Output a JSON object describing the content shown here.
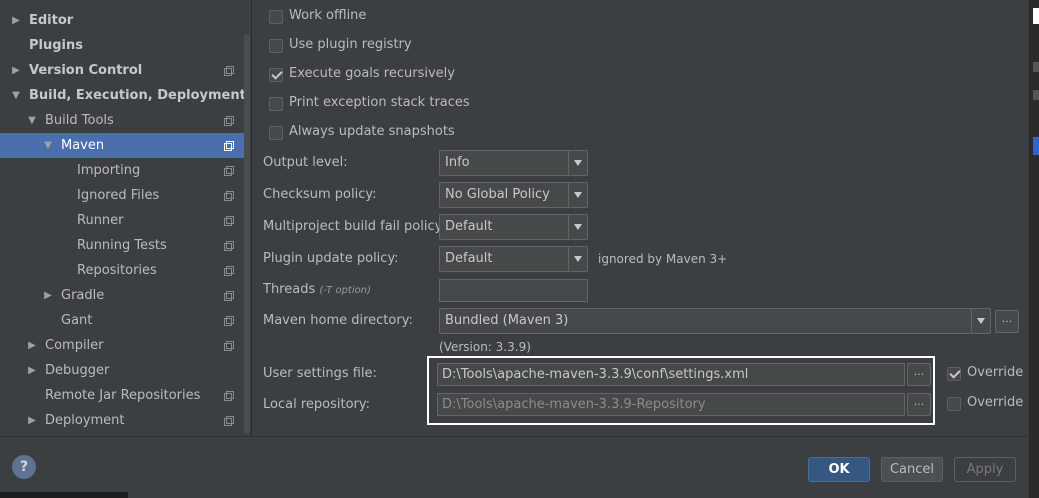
{
  "sidebar": {
    "items": [
      {
        "label": "Editor",
        "bold": true,
        "arrow": "right",
        "project": false
      },
      {
        "label": "Plugins",
        "bold": true,
        "arrow": "",
        "project": false
      },
      {
        "label": "Version Control",
        "bold": true,
        "arrow": "right",
        "project": true
      },
      {
        "label": "Build, Execution, Deployment",
        "bold": true,
        "arrow": "down",
        "project": false
      },
      {
        "label": "Build Tools",
        "bold": false,
        "arrow": "down",
        "project": true
      },
      {
        "label": "Maven",
        "bold": false,
        "arrow": "down",
        "project": true,
        "selected": true
      },
      {
        "label": "Importing",
        "bold": false,
        "arrow": "",
        "project": true
      },
      {
        "label": "Ignored Files",
        "bold": false,
        "arrow": "",
        "project": true
      },
      {
        "label": "Runner",
        "bold": false,
        "arrow": "",
        "project": true
      },
      {
        "label": "Running Tests",
        "bold": false,
        "arrow": "",
        "project": true
      },
      {
        "label": "Repositories",
        "bold": false,
        "arrow": "",
        "project": true
      },
      {
        "label": "Gradle",
        "bold": false,
        "arrow": "right",
        "project": true
      },
      {
        "label": "Gant",
        "bold": false,
        "arrow": "",
        "project": true
      },
      {
        "label": "Compiler",
        "bold": false,
        "arrow": "right",
        "project": true
      },
      {
        "label": "Debugger",
        "bold": false,
        "arrow": "right",
        "project": false
      },
      {
        "label": "Remote Jar Repositories",
        "bold": false,
        "arrow": "",
        "project": true
      },
      {
        "label": "Deployment",
        "bold": false,
        "arrow": "right",
        "project": true
      }
    ]
  },
  "options": {
    "work_offline": {
      "label": "Work offline",
      "checked": false
    },
    "use_plugin_registry": {
      "label": "Use plugin registry",
      "checked": false
    },
    "execute_goals_recursively": {
      "label": "Execute goals recursively",
      "checked": true
    },
    "print_exception_stack_traces": {
      "label": "Print exception stack traces",
      "checked": false
    },
    "always_update_snapshots": {
      "label": "Always update snapshots",
      "checked": false
    }
  },
  "form": {
    "output_level": {
      "label": "Output level:",
      "value": "Info"
    },
    "checksum_policy": {
      "label": "Checksum policy:",
      "value": "No Global Policy"
    },
    "multiproject_fail_policy": {
      "label": "Multiproject build fail policy:",
      "value": "Default"
    },
    "plugin_update_policy": {
      "label": "Plugin update policy:",
      "value": "Default",
      "note": "ignored by Maven 3+"
    },
    "threads": {
      "label": "Threads",
      "hint": "(-T option)",
      "value": ""
    },
    "maven_home": {
      "label": "Maven home directory:",
      "value": "Bundled (Maven 3)",
      "version": "(Version: 3.3.9)",
      "browse": "..."
    },
    "user_settings": {
      "label": "User settings file:",
      "value": "D:\\Tools\\apache-maven-3.3.9\\conf\\settings.xml",
      "browse": "...",
      "override_label": "Override",
      "override_checked": true
    },
    "local_repository": {
      "label": "Local repository:",
      "value": "D:\\Tools\\apache-maven-3.3.9-Repository",
      "browse": "...",
      "override_label": "Override",
      "override_checked": false
    }
  },
  "buttons": {
    "help": "?",
    "ok": "OK",
    "cancel": "Cancel",
    "apply": "Apply"
  },
  "colors": {
    "background": "#3c3f41",
    "selection": "#4b6eaf",
    "ok_button": "#365880",
    "highlight_box": "#ffffff"
  }
}
